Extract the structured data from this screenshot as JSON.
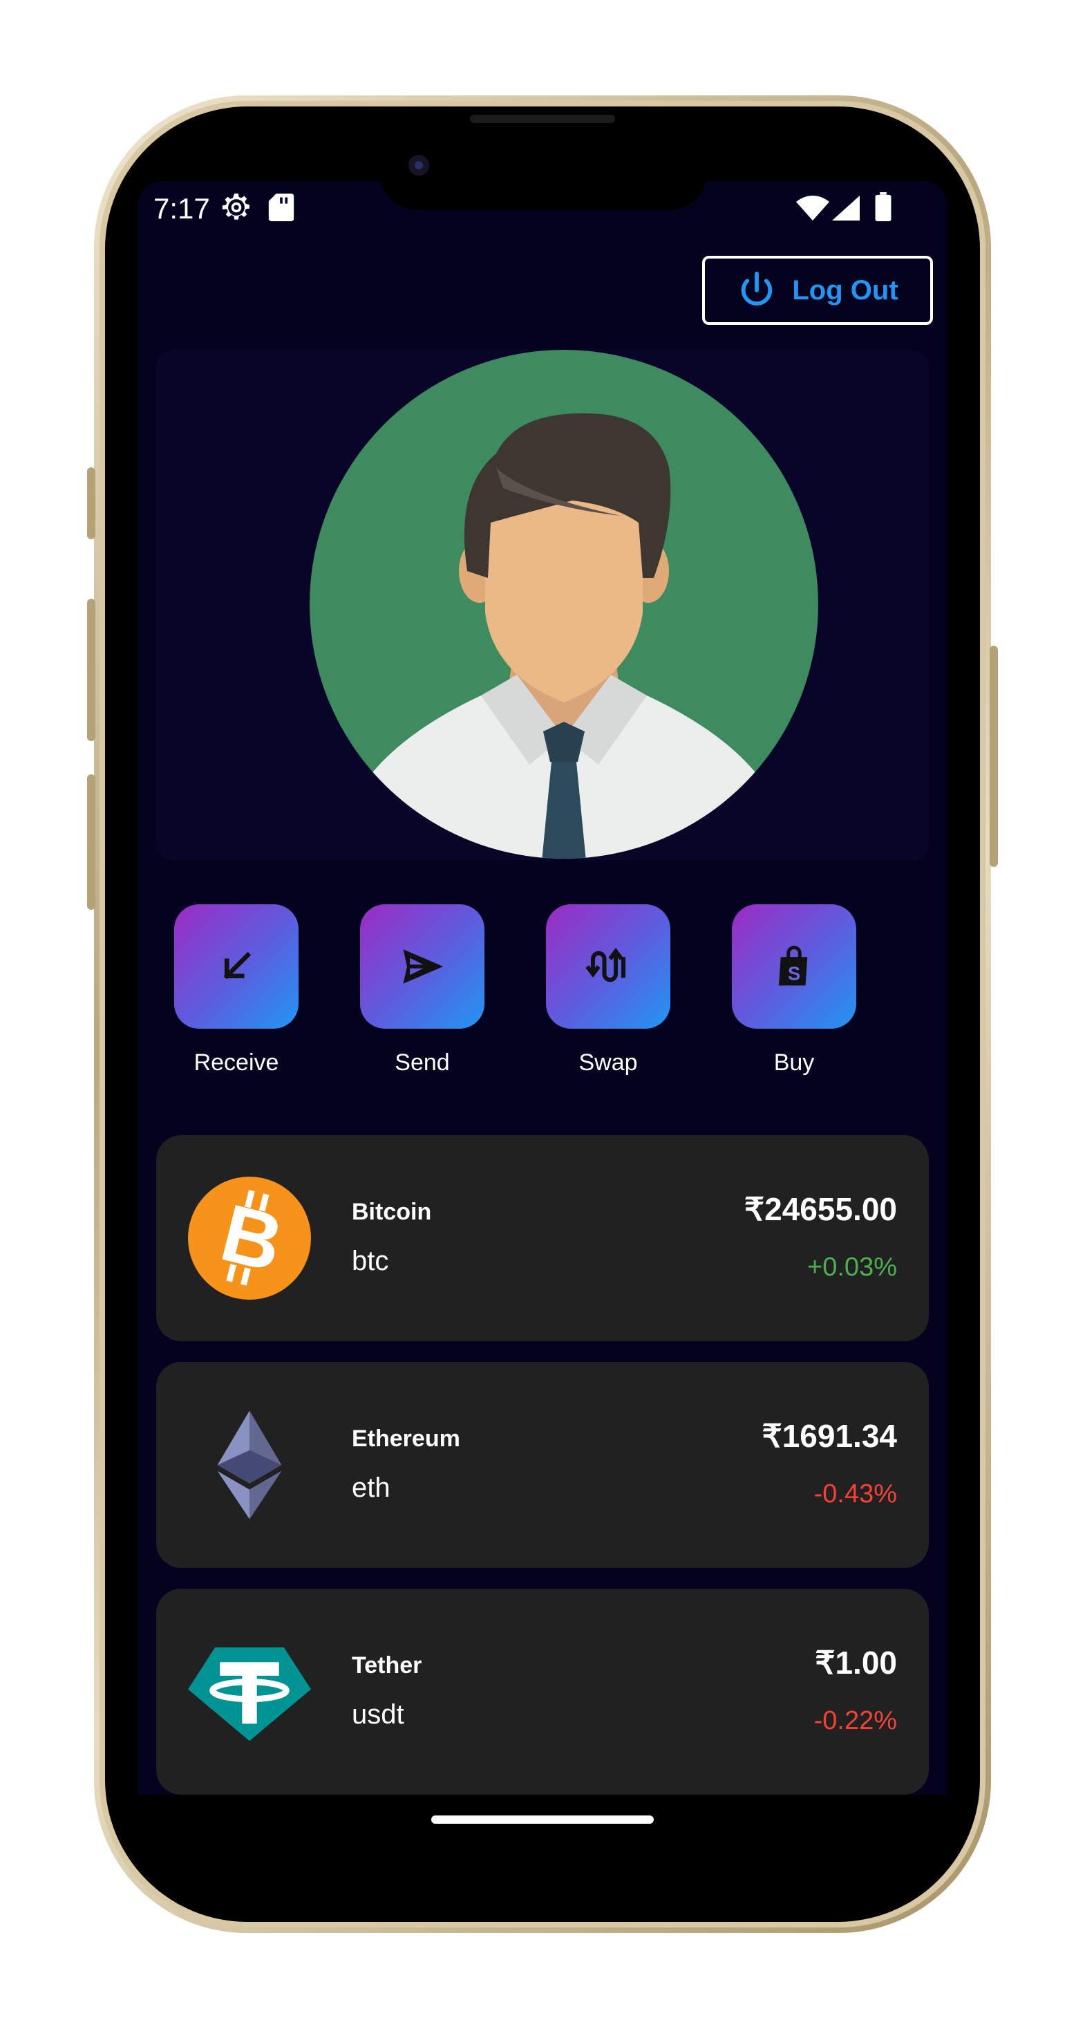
{
  "status_bar": {
    "time": "7:17"
  },
  "header": {
    "logout_label": "Log Out"
  },
  "actions": [
    {
      "label": "Receive",
      "icon": "arrow-down-left-icon"
    },
    {
      "label": "Send",
      "icon": "send-icon"
    },
    {
      "label": "Swap",
      "icon": "swap-icon"
    },
    {
      "label": "Buy",
      "icon": "shopping-bag-icon"
    }
  ],
  "coins": [
    {
      "name": "Bitcoin",
      "symbol": "btc",
      "price": "₹24655.00",
      "change": "+0.03%",
      "change_color": "#4caf50",
      "icon": "bitcoin-icon"
    },
    {
      "name": "Ethereum",
      "symbol": "eth",
      "price": "₹1691.34",
      "change": "-0.43%",
      "change_color": "#f44336",
      "icon": "ethereum-icon"
    },
    {
      "name": "Tether",
      "symbol": "usdt",
      "price": "₹1.00",
      "change": "-0.22%",
      "change_color": "#f44336",
      "icon": "tether-icon"
    }
  ],
  "colors": {
    "background": "#03021f",
    "accent": "#2196f3",
    "card": "#212121",
    "positive": "#4caf50",
    "negative": "#f44336"
  }
}
